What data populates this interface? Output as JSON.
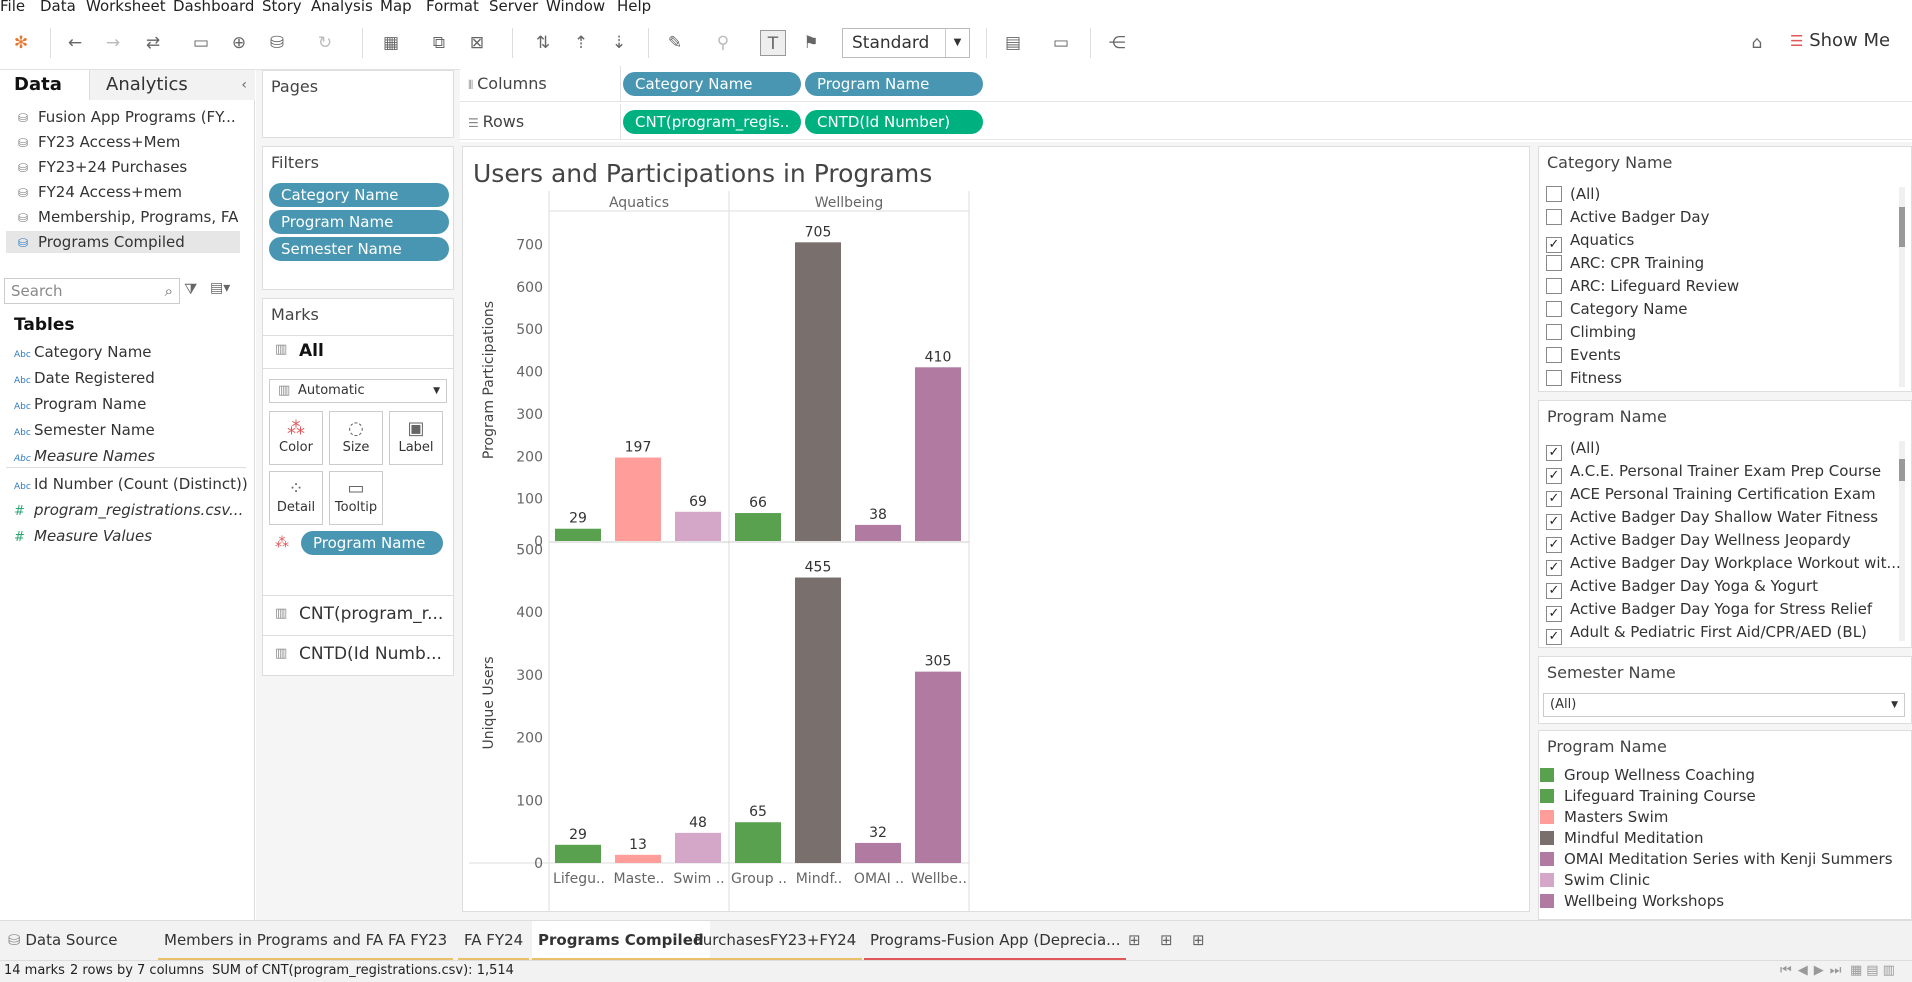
{
  "menu": [
    "File",
    "Data",
    "Worksheet",
    "Dashboard",
    "Story",
    "Analysis",
    "Map",
    "Format",
    "Server",
    "Window",
    "Help"
  ],
  "toolbar": {
    "fit_mode": "Standard",
    "show_me": "Show Me"
  },
  "left": {
    "tabs": {
      "data": "Data",
      "analytics": "Analytics"
    },
    "datasources": [
      {
        "name": "Fusion App Programs (FY..."
      },
      {
        "name": "FY23 Access+Mem"
      },
      {
        "name": "FY23+24 Purchases"
      },
      {
        "name": "FY24 Access+mem"
      },
      {
        "name": "Membership, Programs, FA"
      },
      {
        "name": "Programs Compiled"
      }
    ],
    "search_placeholder": "Search",
    "tables_heading": "Tables",
    "fields": [
      {
        "type": "Abc",
        "name": "Category Name"
      },
      {
        "type": "Abc",
        "name": "Date Registered"
      },
      {
        "type": "Abc",
        "name": "Program Name"
      },
      {
        "type": "Abc",
        "name": "Semester Name"
      },
      {
        "type": "Abc",
        "name": "Measure Names"
      },
      {
        "type": "Abc",
        "name": "Id Number (Count (Distinct))"
      },
      {
        "type": "#",
        "name": "program_registrations.csv..."
      },
      {
        "type": "#",
        "name": "Measure Values"
      }
    ]
  },
  "pages": {
    "title": "Pages"
  },
  "filters": {
    "title": "Filters",
    "items": [
      "Category Name",
      "Program Name",
      "Semester Name"
    ]
  },
  "marks": {
    "title": "Marks",
    "all": "All",
    "type": "Automatic",
    "buttons": [
      "Color",
      "Size",
      "Label",
      "Detail",
      "Tooltip"
    ],
    "color_field": "Program Name",
    "measures": [
      "CNT(program_r...",
      "CNTD(Id Numb..."
    ]
  },
  "shelves": {
    "columns_label": "Columns",
    "columns": [
      "Category Name",
      "Program Name"
    ],
    "rows_label": "Rows",
    "rows": [
      "CNT(program_regis..",
      "CNTD(Id Number)"
    ]
  },
  "chart_data": {
    "type": "bar",
    "title": "Users and Participations in Programs",
    "panels": [
      "Aquatics",
      "Wellbeing"
    ],
    "categories": [
      "Lifegu..",
      "Maste..",
      "Swim ..",
      "Group ..",
      "Mindf..",
      "OMAI ..",
      "Wellbe.."
    ],
    "category_panel": [
      "Aquatics",
      "Aquatics",
      "Aquatics",
      "Wellbeing",
      "Wellbeing",
      "Wellbeing",
      "Wellbeing"
    ],
    "colors": [
      "#59a14f",
      "#ff9d9a",
      "#d4a6c8",
      "#59a14f",
      "#79706e",
      "#b07aa1",
      "#b07aa1"
    ],
    "series": [
      {
        "name": "Program Participations",
        "values": [
          29,
          197,
          69,
          66,
          705,
          38,
          410
        ],
        "ylim": [
          0,
          760
        ],
        "ticks": [
          0,
          100,
          200,
          300,
          400,
          500,
          600,
          700
        ]
      },
      {
        "name": "Unique Users",
        "values": [
          29,
          13,
          48,
          65,
          455,
          32,
          305
        ],
        "ylim": [
          0,
          510
        ],
        "ticks": [
          0,
          100,
          200,
          300,
          400,
          500
        ]
      }
    ]
  },
  "right": {
    "category_filter": {
      "title": "Category Name",
      "items": [
        {
          "label": "(All)",
          "checked": false
        },
        {
          "label": "Active Badger Day",
          "checked": false
        },
        {
          "label": "Aquatics",
          "checked": true
        },
        {
          "label": "ARC: CPR Training",
          "checked": false
        },
        {
          "label": "ARC: Lifeguard Review",
          "checked": false
        },
        {
          "label": "Category Name",
          "checked": false
        },
        {
          "label": "Climbing",
          "checked": false
        },
        {
          "label": "Events",
          "checked": false
        },
        {
          "label": "Fitness",
          "checked": false
        }
      ]
    },
    "program_filter": {
      "title": "Program Name",
      "items": [
        {
          "label": "(All)",
          "checked": true
        },
        {
          "label": "A.C.E. Personal Trainer Exam Prep Course",
          "checked": true
        },
        {
          "label": "ACE Personal Training Certification Exam",
          "checked": true
        },
        {
          "label": "Active Badger Day Shallow Water Fitness",
          "checked": true
        },
        {
          "label": "Active Badger Day Wellness Jeopardy",
          "checked": true
        },
        {
          "label": "Active Badger Day Workplace Workout wit...",
          "checked": true
        },
        {
          "label": "Active Badger Day Yoga & Yogurt",
          "checked": true
        },
        {
          "label": "Active Badger Day Yoga for Stress Relief",
          "checked": true
        },
        {
          "label": "Adult & Pediatric First Aid/CPR/AED (BL)",
          "checked": true
        }
      ]
    },
    "semester_filter": {
      "title": "Semester Name",
      "value": "(All)"
    },
    "legend": {
      "title": "Program Name",
      "items": [
        {
          "label": "Group Wellness Coaching",
          "color": "#59a14f"
        },
        {
          "label": "Lifeguard Training Course",
          "color": "#59a14f"
        },
        {
          "label": "Masters Swim",
          "color": "#ff9d9a"
        },
        {
          "label": "Mindful Meditation",
          "color": "#79706e"
        },
        {
          "label": "OMAI Meditation Series with Kenji Summers",
          "color": "#b07aa1"
        },
        {
          "label": "Swim Clinic",
          "color": "#d4a6c8"
        },
        {
          "label": "Wellbeing Workshops",
          "color": "#b07aa1"
        }
      ]
    }
  },
  "sheets": {
    "data_source": "Data Source",
    "tabs": [
      "Members in Programs and FA",
      "FA FY23",
      "FA FY24",
      "Programs Compiled",
      "PurchasesFY23+FY24",
      "Programs-Fusion App (Deprecia..."
    ],
    "active": "Programs Compiled"
  },
  "status": {
    "marks": "14 marks",
    "rows_cols": "2 rows by 7 columns",
    "sum": "SUM of CNT(program_registrations.csv): 1,514"
  }
}
